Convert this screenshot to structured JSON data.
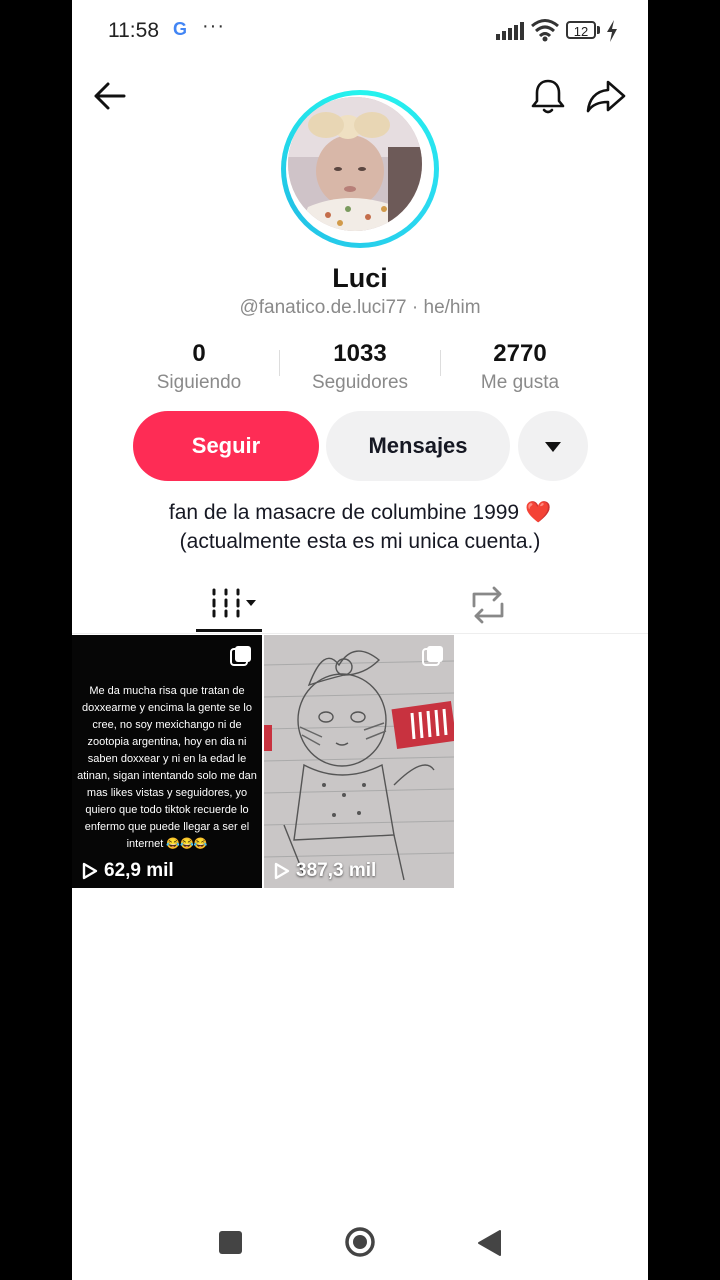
{
  "status_bar": {
    "time": "11:58",
    "g_label": "G",
    "dots": "···",
    "battery": "12"
  },
  "profile": {
    "name": "Luci",
    "handle": "@fanatico.de.luci77 · he/him",
    "stats": [
      {
        "value": "0",
        "label": "Siguiendo"
      },
      {
        "value": "1033",
        "label": "Seguidores"
      },
      {
        "value": "2770",
        "label": "Me gusta"
      }
    ],
    "follow_label": "Seguir",
    "message_label": "Mensajes",
    "bio_line1": "fan de la masacre de columbine 1999 ❤️",
    "bio_line2": "(actualmente esta es mi unica cuenta.)"
  },
  "videos": [
    {
      "text": "Me da mucha risa que tratan de doxxearme y encima la gente se lo cree, no soy mexichango ni de zootopia argentina, hoy en dia ni saben doxxear y ni en la edad le atinan, sigan intentando solo me dan mas likes vistas y seguidores, yo quiero que todo tiktok recuerde lo enfermo que puede llegar a ser el internet 😂😂😂",
      "views": "62,9 mil"
    },
    {
      "text": "",
      "views": "387,3 mil"
    }
  ],
  "colors": {
    "accent": "#FE2C55",
    "ring": "#25F4EE",
    "secondary_button": "#f1f1f2"
  },
  "icons": [
    "back-arrow-icon",
    "bell-icon",
    "share-icon",
    "videos-grid-icon",
    "repost-icon",
    "multi-image-icon",
    "play-icon"
  ]
}
